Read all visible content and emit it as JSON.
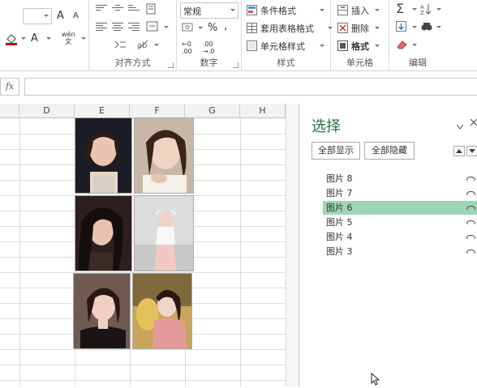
{
  "ribbon": {
    "font_grow": "A",
    "font_shrink": "A",
    "font_color_a": "A",
    "wen_label": "wén\n文",
    "number_format": "常规",
    "percent": "%",
    "comma": ",",
    "alignment_label": "对齐方式",
    "number_label": "数字",
    "styles": {
      "conditional": "条件格式",
      "table": "套用表格格式",
      "cell": "单元格样式",
      "label": "样式"
    },
    "cells": {
      "insert": "插入",
      "delete": "删除",
      "format": "格式",
      "label": "单元格"
    },
    "editing_label": "编辑"
  },
  "formula_bar": {
    "fx": "fx",
    "value": ""
  },
  "columns": [
    "D",
    "E",
    "F",
    "G",
    "H"
  ],
  "selection_pane": {
    "title": "选择",
    "show_all": "全部显示",
    "hide_all": "全部隐藏",
    "items": [
      {
        "label": "图片 8",
        "selected": false
      },
      {
        "label": "图片 7",
        "selected": false
      },
      {
        "label": "图片 6",
        "selected": true
      },
      {
        "label": "图片 5",
        "selected": false
      },
      {
        "label": "图片 4",
        "selected": false
      },
      {
        "label": "图片 3",
        "selected": false
      }
    ]
  },
  "colors": {
    "accent_green": "#217346",
    "selected_row": "#9fd5b7"
  }
}
